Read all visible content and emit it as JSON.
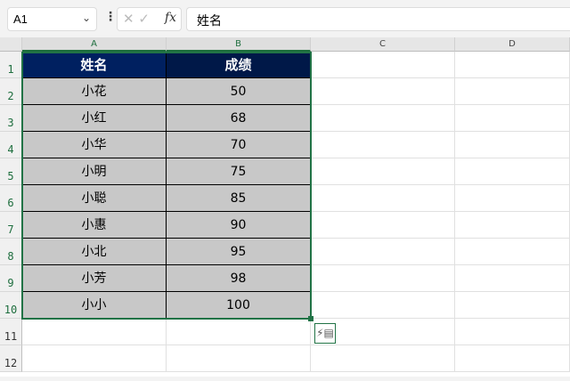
{
  "formula_bar": {
    "name_box": "A1",
    "formula": "姓名",
    "fx_label": "fx",
    "cancel": "✕",
    "enter": "✓"
  },
  "columns": [
    "A",
    "B",
    "C",
    "D"
  ],
  "rows": [
    "1",
    "2",
    "3",
    "4",
    "5",
    "6",
    "7",
    "8",
    "9",
    "10",
    "11",
    "12"
  ],
  "table": {
    "headers": [
      "姓名",
      "成绩"
    ],
    "header_colors": [
      "#002060",
      "#001848"
    ],
    "rows": [
      [
        "小花",
        "50"
      ],
      [
        "小红",
        "68"
      ],
      [
        "小华",
        "70"
      ],
      [
        "小明",
        "75"
      ],
      [
        "小聪",
        "85"
      ],
      [
        "小惠",
        "90"
      ],
      [
        "小北",
        "95"
      ],
      [
        "小芳",
        "98"
      ],
      [
        "小小",
        "100"
      ]
    ]
  },
  "quick_analysis_icon": "quick-analysis-icon"
}
